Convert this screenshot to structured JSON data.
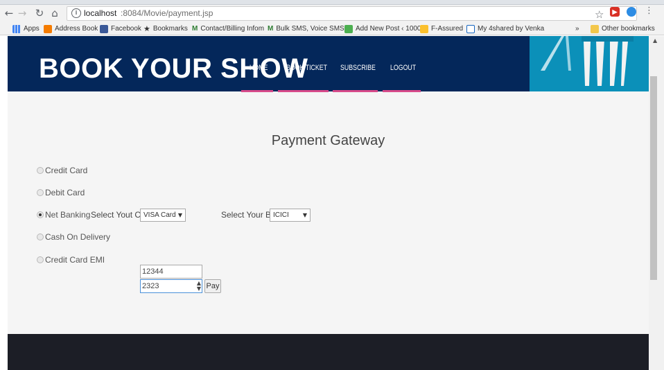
{
  "browser": {
    "url_host": "localhost",
    "url_path": ":8084/Movie/payment.jsp",
    "bookmarks": [
      {
        "label": "Apps",
        "color": "#4285f4"
      },
      {
        "label": "Address Book",
        "color": "#f57c00"
      },
      {
        "label": "Facebook",
        "color": "#3b5998"
      },
      {
        "label": "Bookmarks",
        "color": "#333333"
      },
      {
        "label": "Contact/Billing Infom",
        "color": "#2e7d32"
      },
      {
        "label": "Bulk SMS, Voice SMS",
        "color": "#2e7d32"
      },
      {
        "label": "Add New Post ‹ 1000",
        "color": "#4caf50"
      },
      {
        "label": "F-Assured",
        "color": "#fbc02d"
      },
      {
        "label": "My 4shared by Venka",
        "color": "#1565c0"
      }
    ],
    "overflow": "»",
    "other_bookmarks": "Other bookmarks"
  },
  "site": {
    "logo": "BOOK YOUR SHOW",
    "nav": [
      "HOME",
      "BOOK TICKET",
      "SUBSCRIBE",
      "LOGOUT"
    ]
  },
  "payment": {
    "title": "Payment Gateway",
    "options": [
      "Credit Card",
      "Debit Card",
      "Net Banking",
      "Cash On Delivery",
      "Credit Card EMI"
    ],
    "selected_option": "Net Banking",
    "card_label": "Select Yout Card:",
    "card_value": "VISA Card",
    "bank_label": "Select Your Bank",
    "bank_value": "ICICI",
    "card_number": "12344",
    "cvv": "2323",
    "pay_label": "Pay"
  },
  "colors": {
    "header": "#04275a",
    "nav_underline": "#d84a8a",
    "footer": "#1c1e26",
    "banner": "#0b90b9"
  }
}
